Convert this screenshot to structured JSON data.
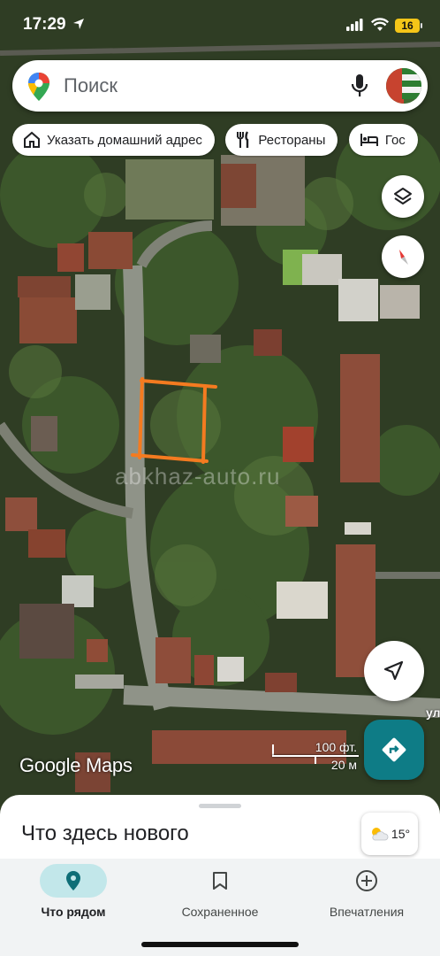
{
  "status_bar": {
    "time": "17:29",
    "battery": "16",
    "icons": [
      "location-arrow-icon",
      "signal-icon",
      "wifi-icon",
      "battery-icon"
    ]
  },
  "search": {
    "placeholder": "Поиск",
    "icons": [
      "maps-pin-icon",
      "microphone-icon",
      "avatar"
    ]
  },
  "chips": [
    {
      "label": "Указать домашний адрес",
      "icon": "home-icon"
    },
    {
      "label": "Рестораны",
      "icon": "fork-knife-icon"
    },
    {
      "label": "Гос",
      "icon": "bed-icon"
    }
  ],
  "map": {
    "watermark": "abkhaz-auto.ru",
    "street_label": "ул",
    "logo": "Google Maps",
    "scale": {
      "feet": "100 фт.",
      "meters": "20 м"
    },
    "colors": {
      "marker": "#f47b20",
      "directions_button": "#0e7c86"
    }
  },
  "sheet": {
    "title": "Что здесь нового",
    "weather": "15°"
  },
  "bottom_nav": [
    {
      "label": "Что рядом",
      "icon": "location-pin-icon",
      "active": true
    },
    {
      "label": "Сохраненное",
      "icon": "bookmark-icon",
      "active": false
    },
    {
      "label": "Впечатления",
      "icon": "add-circle-icon",
      "active": false
    }
  ]
}
